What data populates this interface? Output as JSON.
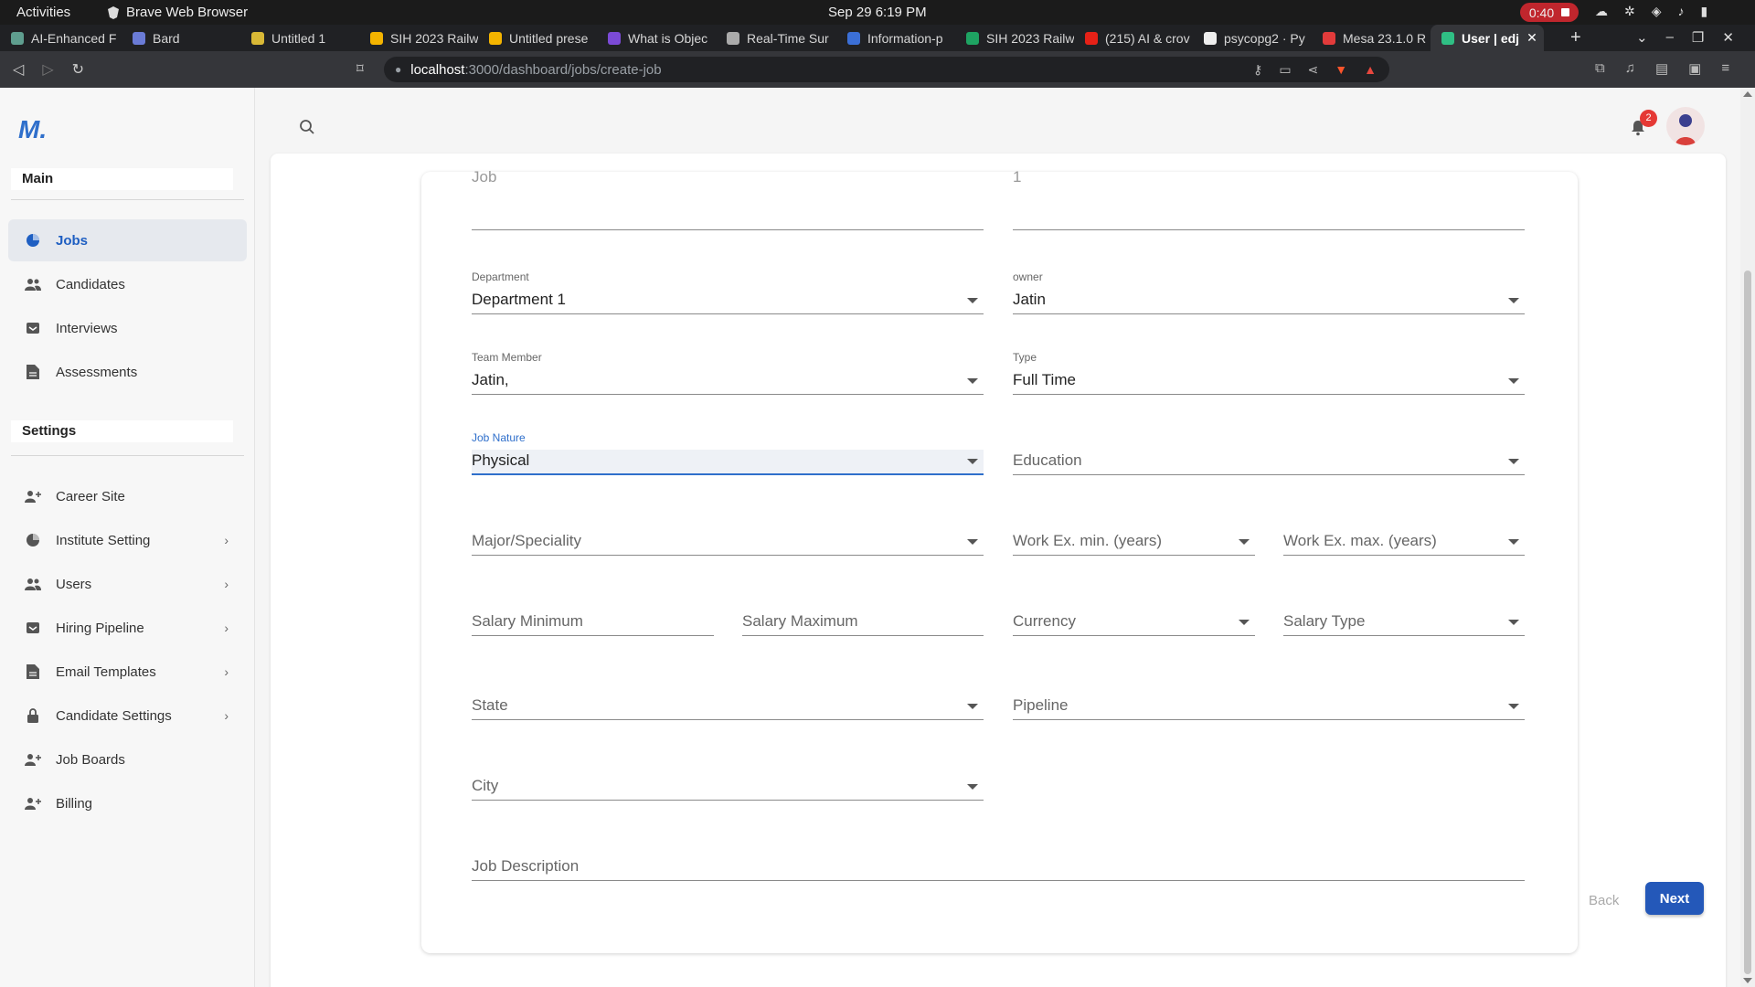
{
  "system": {
    "activities": "Activities",
    "app_name": "Brave Web Browser",
    "clock": "Sep 29  6:19 PM",
    "recording_time": "0:40"
  },
  "browser": {
    "tabs": [
      {
        "label": "AI-Enhanced F",
        "color": "#5f9e8f"
      },
      {
        "label": "Bard",
        "color": "#6a7bd6"
      },
      {
        "label": "Untitled 1",
        "color": "#d8b836"
      },
      {
        "label": "SIH 2023 Railw",
        "color": "#f4b400"
      },
      {
        "label": "Untitled prese",
        "color": "#f4b400"
      },
      {
        "label": "What is Objec",
        "color": "#7b4ad6"
      },
      {
        "label": "Real-Time Sur",
        "color": "#aaaaaa"
      },
      {
        "label": "Information-p",
        "color": "#3b6fd6"
      },
      {
        "label": "SIH 2023 Railw",
        "color": "#1ea362"
      },
      {
        "label": "(215) AI & crov",
        "color": "#e62117"
      },
      {
        "label": "psycopg2 · Py",
        "color": "#eeeeee"
      },
      {
        "label": "Mesa 23.1.0 R",
        "color": "#e23b3b"
      }
    ],
    "active_tab": {
      "label": "User | edj",
      "color": "#2fbf84"
    },
    "url_host": "localhost",
    "url_path": ":3000/dashboard/jobs/create-job"
  },
  "sidebar": {
    "logo_text": "M.",
    "main_label": "Main",
    "main_items": [
      {
        "label": "Jobs",
        "icon": "pie-chart-icon",
        "active": true
      },
      {
        "label": "Candidates",
        "icon": "people-icon"
      },
      {
        "label": "Interviews",
        "icon": "inbox-icon"
      },
      {
        "label": "Assessments",
        "icon": "document-icon"
      }
    ],
    "settings_label": "Settings",
    "settings_items": [
      {
        "label": "Career Site",
        "icon": "person-add-icon",
        "chevron": false
      },
      {
        "label": "Institute Setting",
        "icon": "pie-chart-icon",
        "chevron": true
      },
      {
        "label": "Users",
        "icon": "people-icon",
        "chevron": true
      },
      {
        "label": "Hiring Pipeline",
        "icon": "inbox-icon",
        "chevron": true
      },
      {
        "label": "Email Templates",
        "icon": "document-icon",
        "chevron": true
      },
      {
        "label": "Candidate Settings",
        "icon": "lock-icon",
        "chevron": true
      },
      {
        "label": "Job Boards",
        "icon": "person-add-icon",
        "chevron": false
      },
      {
        "label": "Billing",
        "icon": "person-add-icon",
        "chevron": false
      }
    ]
  },
  "header": {
    "notification_count": "2"
  },
  "form": {
    "top_left_value": "Job",
    "top_right_value": "1",
    "department": {
      "label": "Department",
      "value": "Department 1"
    },
    "owner": {
      "label": "owner",
      "value": "Jatin"
    },
    "team_member": {
      "label": "Team Member",
      "value": "Jatin,"
    },
    "type": {
      "label": "Type",
      "value": "Full Time"
    },
    "job_nature": {
      "label": "Job Nature",
      "value": "Physical"
    },
    "education": {
      "placeholder": "Education"
    },
    "major": {
      "placeholder": "Major/Speciality"
    },
    "work_ex_min": {
      "placeholder": "Work Ex. min. (years)"
    },
    "work_ex_max": {
      "placeholder": "Work Ex. max. (years)"
    },
    "salary_min": {
      "placeholder": "Salary Minimum"
    },
    "salary_max": {
      "placeholder": "Salary Maximum"
    },
    "currency": {
      "placeholder": "Currency"
    },
    "salary_type": {
      "placeholder": "Salary Type"
    },
    "state": {
      "placeholder": "State"
    },
    "pipeline": {
      "placeholder": "Pipeline"
    },
    "city": {
      "placeholder": "City"
    },
    "job_description": {
      "placeholder": "Job Description"
    }
  },
  "actions": {
    "back": "Back",
    "next": "Next"
  },
  "colors": {
    "primary": "#2458b9",
    "focus": "#2f6fcb",
    "badge": "#e53935"
  }
}
